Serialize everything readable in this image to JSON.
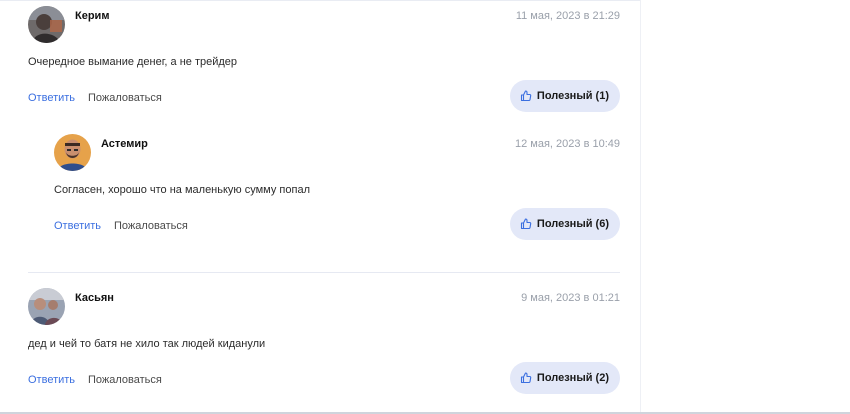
{
  "comments": [
    {
      "author": "Керим",
      "date": "11 мая, 2023 в 21:29",
      "text": "Очередное вымание денег, а не трейдер",
      "reply_label": "Ответить",
      "complain_label": "Пожаловаться",
      "useful_label": "Полезный (1)"
    },
    {
      "author": "Астемир",
      "date": "12 мая, 2023 в 10:49",
      "text": "Согласен, хорошо что на маленькую сумму попал",
      "reply_label": "Ответить",
      "complain_label": "Пожаловаться",
      "useful_label": "Полезный (6)"
    },
    {
      "author": "Касьян",
      "date": "9 мая, 2023 в 01:21",
      "text": "дед и чей то батя не хило так людей киданули",
      "reply_label": "Ответить",
      "complain_label": "Пожаловаться",
      "useful_label": "Полезный (2)"
    }
  ],
  "colors": {
    "link": "#3b6fe0",
    "useful_bg": "#e3e8f8",
    "date": "#9aa0aa"
  },
  "icons": {
    "useful": "thumbs-up-icon"
  }
}
